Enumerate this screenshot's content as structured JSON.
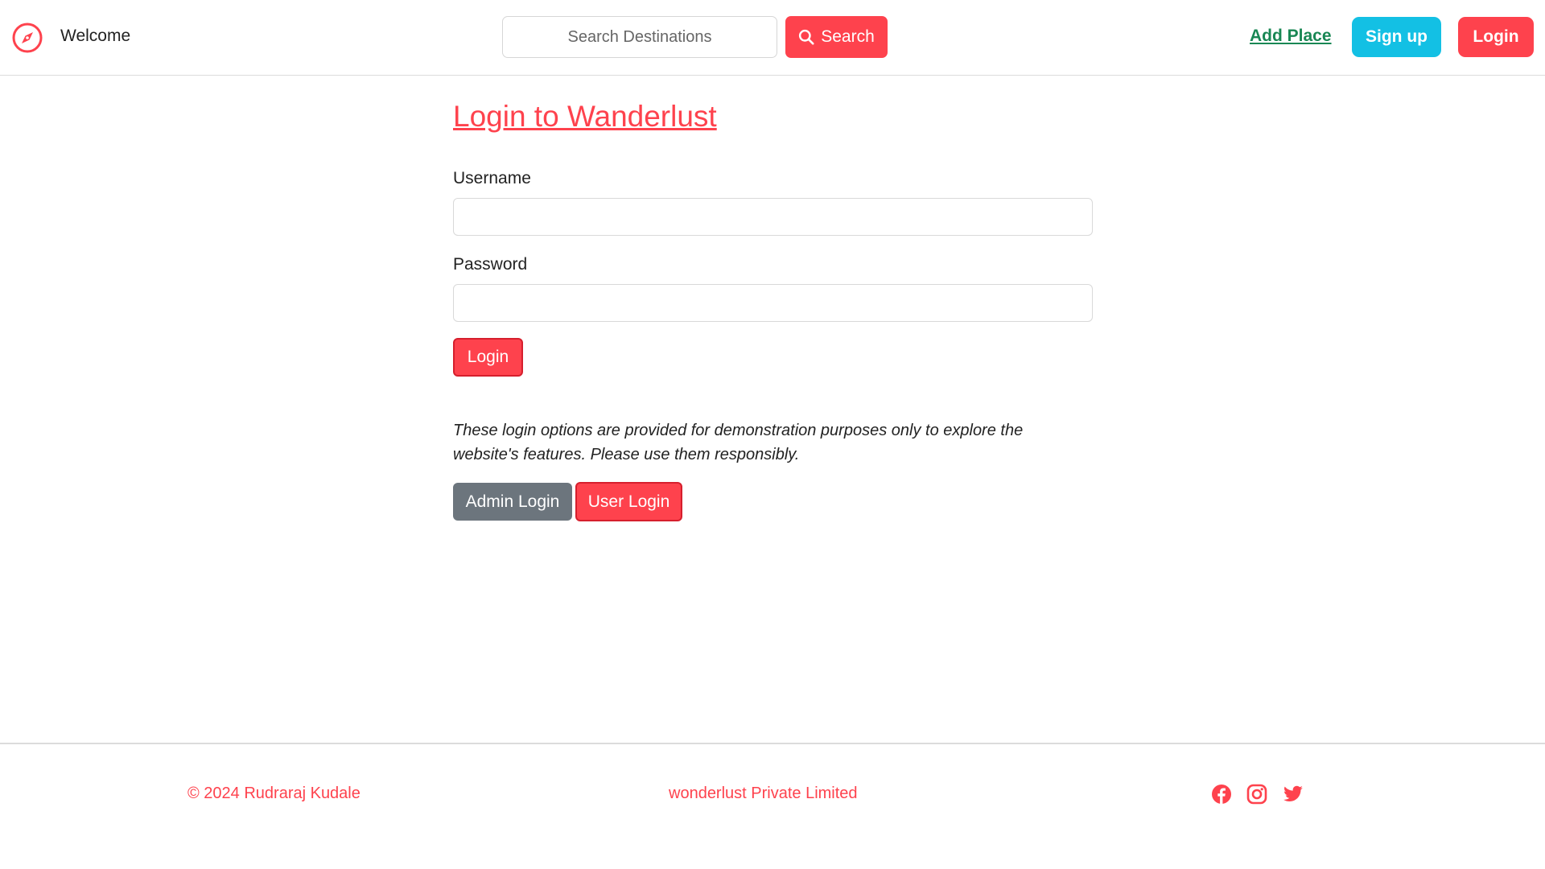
{
  "navbar": {
    "brand_icon": "compass-icon",
    "brand_text": "Welcome",
    "search": {
      "placeholder": "Search Destinations",
      "button_label": "Search",
      "button_icon": "search-icon"
    },
    "add_place_label": "Add Place",
    "signup_label": "Sign up",
    "login_label": "Login"
  },
  "main": {
    "title": "Login to Wanderlust",
    "username_label": "Username",
    "username_value": "",
    "password_label": "Password",
    "password_value": "",
    "submit_label": "Login",
    "note": "These login options are provided for demonstration purposes only to explore the website's features. Please use them responsibly.",
    "admin_login_label": "Admin Login",
    "user_login_label": "User Login"
  },
  "footer": {
    "copyright": "© 2024 Rudraraj Kudale",
    "company": "wonderlust Private Limited",
    "social_icons": [
      "facebook-icon",
      "instagram-icon",
      "twitter-icon"
    ]
  },
  "colors": {
    "brand": "#fe424d",
    "link_green": "#198754",
    "signup_cyan": "#13c0e4",
    "secondary_gray": "#6c757d"
  }
}
